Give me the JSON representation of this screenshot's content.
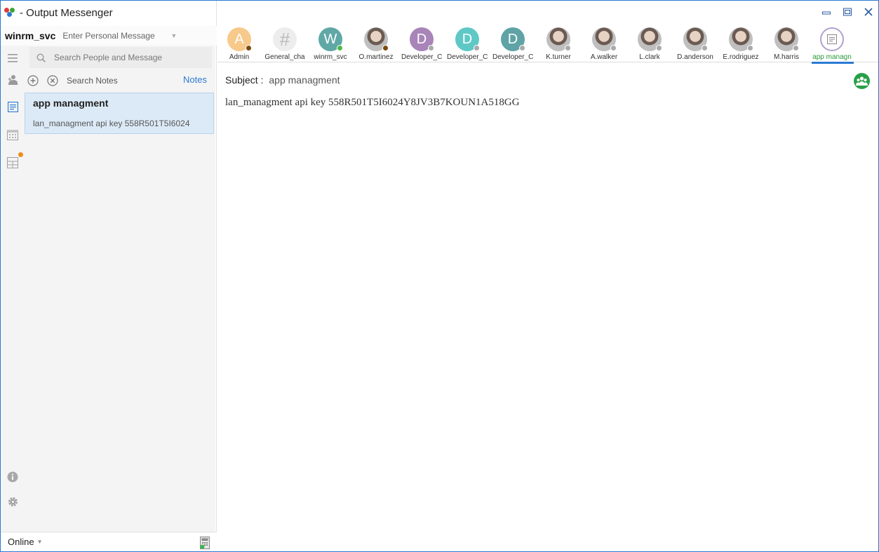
{
  "app": {
    "title": "- Output Messenger"
  },
  "user": {
    "name": "winrm_svc",
    "personal_message_placeholder": "Enter Personal Message"
  },
  "search": {
    "placeholder": "Search People and Message"
  },
  "notes_panel": {
    "search_label": "Search Notes",
    "notes_link": "Notes",
    "items": [
      {
        "title": "app managment",
        "preview": "lan_managment  api key 558R501T5I6024"
      }
    ]
  },
  "status": {
    "label": "Online"
  },
  "contacts": [
    {
      "name": "Admin",
      "initial": "A",
      "avatar_color": "#f7c98a",
      "status_color": "#7a4a12",
      "kind": "initial"
    },
    {
      "name": "General_cha",
      "initial": "#",
      "avatar_color": "#ededed",
      "status_color": "",
      "kind": "channel"
    },
    {
      "name": "winrm_svc",
      "initial": "W",
      "avatar_color": "#5fa8a6",
      "status_color": "#4cb848",
      "kind": "initial"
    },
    {
      "name": "O.martinez",
      "initial": "",
      "avatar_color": "",
      "status_color": "#7a4a12",
      "kind": "photo"
    },
    {
      "name": "Developer_C",
      "initial": "D",
      "avatar_color": "#a884b8",
      "status_color": "#aaaaaa",
      "kind": "initial"
    },
    {
      "name": "Developer_C",
      "initial": "D",
      "avatar_color": "#5ec8c6",
      "status_color": "#aaaaaa",
      "kind": "initial"
    },
    {
      "name": "Developer_C",
      "initial": "D",
      "avatar_color": "#5fa3a6",
      "status_color": "#aaaaaa",
      "kind": "initial"
    },
    {
      "name": "K.turner",
      "initial": "",
      "avatar_color": "",
      "status_color": "#aaaaaa",
      "kind": "photo"
    },
    {
      "name": "A.walker",
      "initial": "",
      "avatar_color": "",
      "status_color": "#aaaaaa",
      "kind": "photo"
    },
    {
      "name": "L.clark",
      "initial": "",
      "avatar_color": "",
      "status_color": "#aaaaaa",
      "kind": "photo"
    },
    {
      "name": "D.anderson",
      "initial": "",
      "avatar_color": "",
      "status_color": "#aaaaaa",
      "kind": "photo"
    },
    {
      "name": "E.rodriguez",
      "initial": "",
      "avatar_color": "",
      "status_color": "#aaaaaa",
      "kind": "photo"
    },
    {
      "name": "M.harris",
      "initial": "",
      "avatar_color": "",
      "status_color": "#aaaaaa",
      "kind": "photo"
    },
    {
      "name": "app managn",
      "initial": "",
      "avatar_color": "#ffffff",
      "status_color": "",
      "kind": "note"
    }
  ],
  "note": {
    "subject_label": "Subject :",
    "subject_value": "app managment",
    "body": "lan_managment  api key 558R501T5I6024Y8JV3B7KOUN1A518GG"
  },
  "colors": {
    "accent": "#2a7bd3",
    "green": "#27a046",
    "orange_badge": "#f08c1e"
  }
}
